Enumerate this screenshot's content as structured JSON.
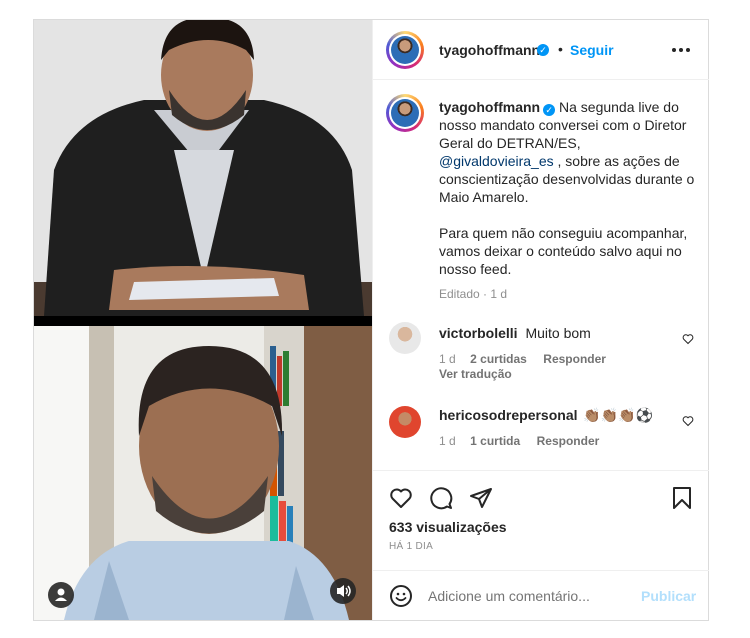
{
  "header": {
    "username": "tyagohoffmann",
    "follow_label": "Seguir",
    "separator": "•"
  },
  "caption": {
    "username": "tyagohoffmann",
    "text_part1": "Na segunda live do nosso mandato conversei com o Diretor Geral do DETRAN/ES,",
    "mention": "@givaldovieira_es",
    "text_part2": ", sobre as ações de conscientização desenvolvidas durante o Maio Amarelo.",
    "paragraph2": "Para quem não conseguiu acompanhar, vamos deixar o conteúdo salvo aqui no nosso feed.",
    "meta": "Editado · 1 d"
  },
  "comments": [
    {
      "username": "victorbolelli",
      "text": "Muito bom",
      "time": "1 d",
      "likes": "2 curtidas",
      "reply": "Responder",
      "translate": "Ver tradução"
    },
    {
      "username": "hericosodrepersonal",
      "text": "👏🏽👏🏽👏🏽⚽",
      "time": "1 d",
      "likes": "1 curtida",
      "reply": "Responder"
    }
  ],
  "stats": {
    "views": "633 visualizações",
    "date": "HÁ 1 DIA"
  },
  "add_comment": {
    "placeholder": "Adicione um comentário...",
    "publish_label": "Publicar"
  },
  "icons": {
    "like": "heart-icon",
    "comment": "comment-icon",
    "share": "share-icon",
    "save": "bookmark-icon",
    "more": "more-options-icon",
    "emoji": "emoji-icon",
    "user_tag": "user-tag-icon",
    "audio": "speaker-icon"
  },
  "colors": {
    "accent": "#0095f6",
    "publish_disabled": "#b2dffc",
    "muted": "#8e8e8e"
  }
}
